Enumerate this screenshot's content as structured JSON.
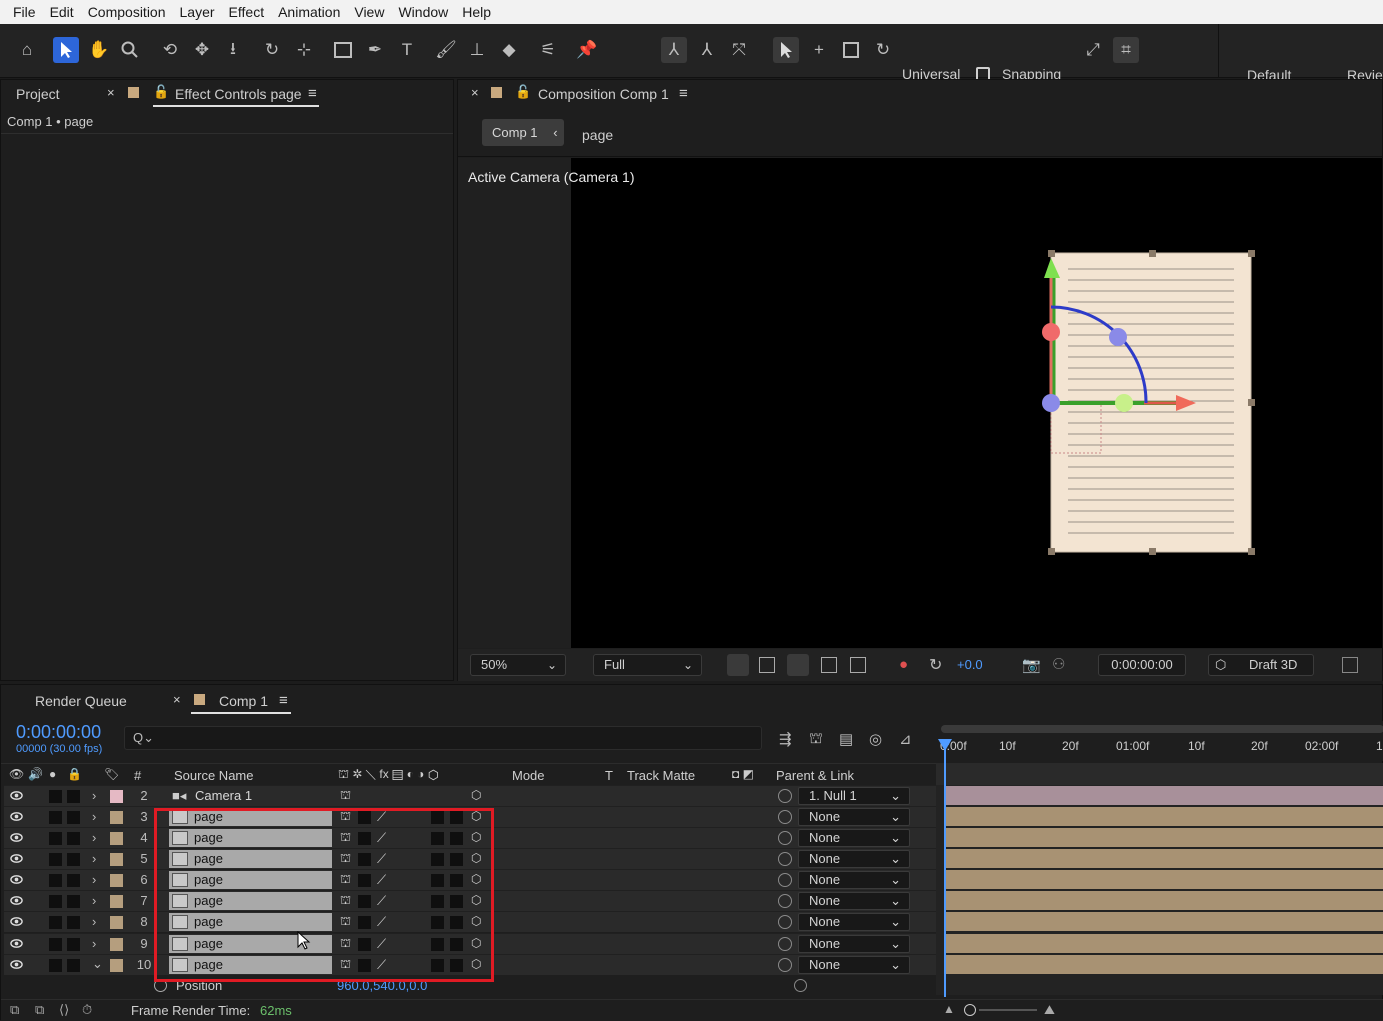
{
  "menu": [
    "File",
    "Edit",
    "Composition",
    "Layer",
    "Effect",
    "Animation",
    "View",
    "Window",
    "Help"
  ],
  "toolbar": {
    "universal_label": "Universal",
    "snapping_label": "Snapping",
    "workspace_default": "Default",
    "workspace_review": "Review"
  },
  "left_panel": {
    "tab_project": "Project",
    "tab_effect_controls": "Effect Controls page",
    "subtitle": "Comp 1 • page"
  },
  "viewer": {
    "tab_title": "Composition Comp 1",
    "breadcrumb_comp": "Comp 1",
    "breadcrumb_layer": "page",
    "camera_label": "Active Camera (Camera 1)",
    "zoom": "50%",
    "resolution": "Full",
    "exposure": "+0.0",
    "timecode": "0:00:00:00",
    "renderer": "Draft 3D"
  },
  "timeline": {
    "tab_render_queue": "Render Queue",
    "tab_comp": "Comp 1",
    "timecode": "0:00:00:00",
    "frame_info": "00000 (30.00 fps)",
    "search_placeholder": "",
    "columns": {
      "num": "#",
      "source_name": "Source Name",
      "mode": "Mode",
      "t": "T",
      "track_matte": "Track Matte",
      "parent_link": "Parent & Link"
    },
    "ruler": [
      "0:00f",
      "10f",
      "20f",
      "01:00f",
      "10f",
      "20f",
      "02:00f",
      "1"
    ],
    "layers": [
      {
        "num": "2",
        "name": "Camera 1",
        "parent": "1. Null 1",
        "label_color": "#e5b9c4"
      },
      {
        "num": "3",
        "name": "page",
        "parent": "None",
        "label_color": "#b59e7e"
      },
      {
        "num": "4",
        "name": "page",
        "parent": "None",
        "label_color": "#b59e7e"
      },
      {
        "num": "5",
        "name": "page",
        "parent": "None",
        "label_color": "#b59e7e"
      },
      {
        "num": "6",
        "name": "page",
        "parent": "None",
        "label_color": "#b59e7e"
      },
      {
        "num": "7",
        "name": "page",
        "parent": "None",
        "label_color": "#b59e7e"
      },
      {
        "num": "8",
        "name": "page",
        "parent": "None",
        "label_color": "#b59e7e"
      },
      {
        "num": "9",
        "name": "page",
        "parent": "None",
        "label_color": "#b59e7e"
      },
      {
        "num": "10",
        "name": "page",
        "parent": "None",
        "label_color": "#b59e7e"
      }
    ],
    "property_name": "Position",
    "property_value": "960.0,540.0,0.0",
    "frame_render_label": "Frame Render Time:",
    "frame_render_value": "62ms"
  },
  "colors": {
    "accent_blue": "#2d66d9",
    "timecode_blue": "#4f9bff",
    "highlight_red": "#e01b24",
    "page_fill": "#f3e4d2"
  }
}
